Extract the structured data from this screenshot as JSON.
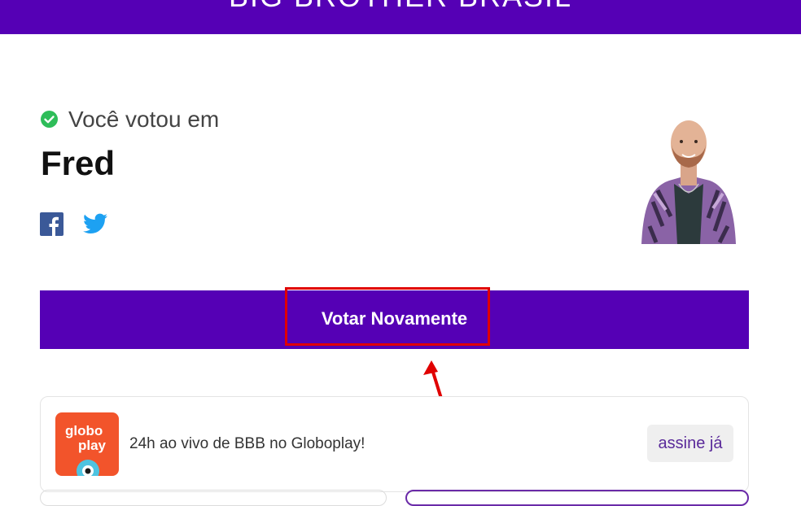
{
  "header": {
    "title": "BIG BROTHER BRASIL"
  },
  "vote": {
    "status_label": "Você votou em",
    "candidate_name": "Fred"
  },
  "share": {
    "facebook_icon": "facebook-icon",
    "twitter_icon": "twitter-icon"
  },
  "actions": {
    "vote_again_label": "Votar Novamente"
  },
  "promo": {
    "logo_line1": "globo",
    "logo_line2": "play",
    "text": "24h ao vivo de BBB no Globoplay!",
    "cta_label": "assine já"
  },
  "colors": {
    "brand_purple": "#5500b5",
    "highlight_red": "#e00000",
    "success_green": "#2ebd59",
    "globoplay_orange": "#f2542b"
  }
}
